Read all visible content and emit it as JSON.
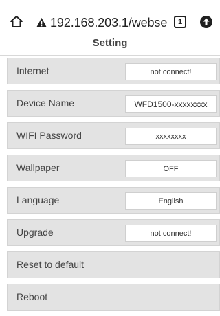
{
  "browser": {
    "url": "192.168.203.1/webse",
    "tab_count": "1",
    "icons": {
      "home": "home-icon",
      "security_warning": "warning-icon",
      "tabs": "tabs-icon",
      "upload": "upload-icon"
    }
  },
  "page": {
    "title": "Setting"
  },
  "settings": [
    {
      "label": "Internet",
      "value": "not connect!"
    },
    {
      "label": "Device Name",
      "value": "WFD1500-xxxxxxxx"
    },
    {
      "label": "WIFI Password",
      "value": "xxxxxxxx"
    },
    {
      "label": "Wallpaper",
      "value": "OFF"
    },
    {
      "label": "Language",
      "value": "English"
    },
    {
      "label": "Upgrade",
      "value": "not connect!"
    },
    {
      "label": "Reset to default"
    },
    {
      "label": "Reboot"
    }
  ],
  "colors": {
    "row_background": "#e3e3e3",
    "text": "#444444",
    "value_background": "#ffffff"
  }
}
